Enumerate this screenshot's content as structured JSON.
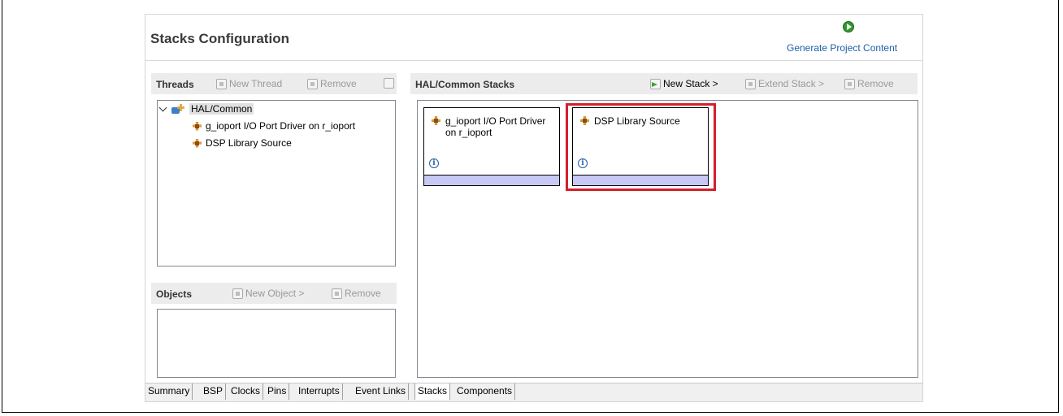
{
  "editor": {
    "title": "Stacks Configuration",
    "generate_label": "Generate Project Content"
  },
  "threads": {
    "title": "Threads",
    "new_thread": "New Thread",
    "remove": "Remove",
    "tree": {
      "root": "HAL/Common",
      "children": [
        "g_ioport I/O Port Driver on r_ioport",
        "DSP Library Source"
      ]
    }
  },
  "objects": {
    "title": "Objects",
    "new_object": "New Object >",
    "remove": "Remove"
  },
  "stacks": {
    "title": "HAL/Common Stacks",
    "new_stack": "New Stack >",
    "extend_stack": "Extend Stack >",
    "remove": "Remove",
    "cards": [
      {
        "title": "g_ioport I/O Port Driver on r_ioport"
      },
      {
        "title": "DSP Library Source",
        "highlighted": true
      }
    ]
  },
  "tabs": {
    "items": [
      "Summary",
      "BSP",
      "Clocks",
      "Pins",
      "Interrupts",
      "Event Links",
      "Stacks",
      "Components"
    ],
    "active": "Stacks"
  },
  "colors": {
    "highlight": "#d41f2c",
    "card_bar": "#c8c8f5",
    "link": "#1f5fa8"
  }
}
